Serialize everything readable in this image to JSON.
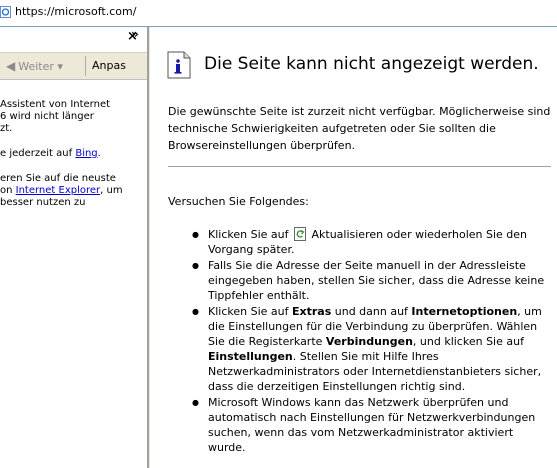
{
  "address_bar": {
    "url": "https://microsoft.com/"
  },
  "sidebar": {
    "close_label": "×",
    "forward_label": "Weiter",
    "forward_arrow": "◀",
    "customize_label": "Anpas",
    "more_label": "»",
    "text_lines": [
      "Assistent von Internet",
      "6 wird nicht länger",
      "zt."
    ],
    "bing_prefix": "e jederzeit auf ",
    "bing_link": "Bing",
    "bing_suffix": ".",
    "update_lines": [
      "eren Sie auf die neuste",
      "on "
    ],
    "ie_link": "Internet Explorer",
    "ie_suffix": ", um",
    "update_last": "besser nutzen zu"
  },
  "main": {
    "title": "Die Seite kann nicht angezeigt werden.",
    "description": "Die gewünschte Seite ist zurzeit nicht verfügbar. Möglicherweise sind technische Schwierigkeiten aufgetreten oder Sie sollten die Browsereinstellungen überprüfen.",
    "try_label": "Versuchen Sie Folgendes:",
    "step1_before": "Klicken Sie auf",
    "step1_after": "Aktualisieren oder wiederholen Sie den Vorgang später.",
    "step2": "Falls Sie die Adresse der Seite manuell in der Adressleiste eingegeben haben, stellen Sie sicher, dass die Adresse keine Tippfehler enthält.",
    "step3_a": "Klicken Sie auf ",
    "step3_extras": "Extras",
    "step3_b": " und dann auf ",
    "step3_options": "Internetoptionen",
    "step3_c": ", um die Einstellungen für die Verbindung zu überprüfen. Wählen Sie die Registerkarte ",
    "step3_conn": "Verbindungen",
    "step3_d": ", und klicken Sie auf ",
    "step3_settings": "Einstellungen",
    "step3_e": ". Stellen Sie mit Hilfe Ihres Netzwerkadministrators oder Internetdienstanbieters sicher, dass die derzeitigen Einstellungen richtig sind.",
    "step4": "Microsoft Windows kann das Netzwerk überprüfen und automatisch nach Einstellungen für Netzwerkverbindungen suchen, wenn das vom Netzwerkadministrator aktiviert wurde."
  }
}
